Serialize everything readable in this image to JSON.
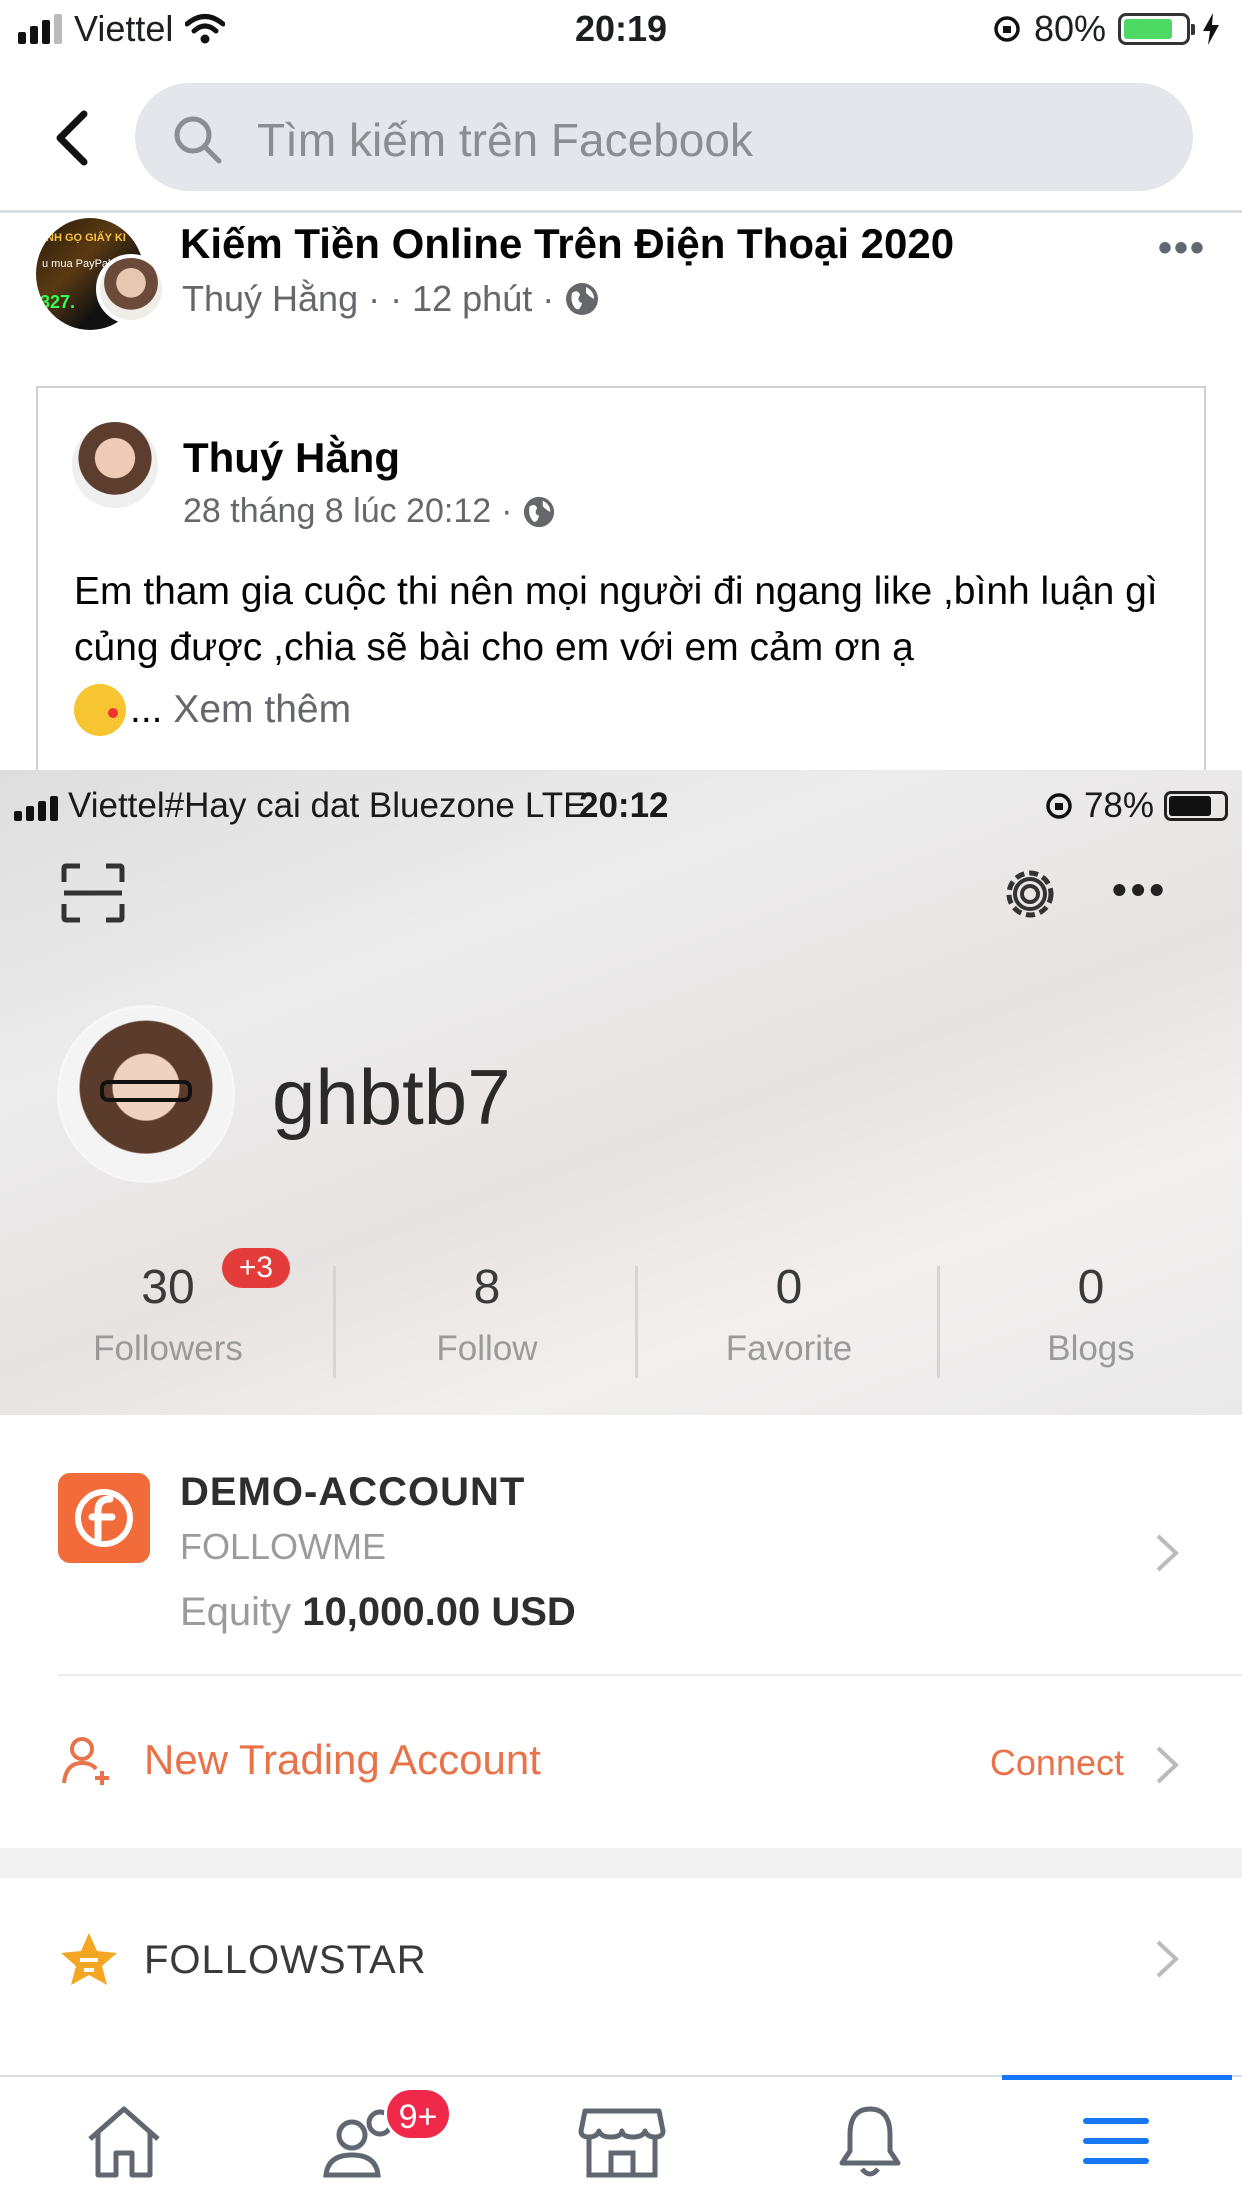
{
  "status_bar": {
    "carrier": "Viettel",
    "time": "20:19",
    "battery_percent": "80%",
    "battery_level": 0.8,
    "battery_color": "#4cd964"
  },
  "header": {
    "back_icon": "chevron-left-icon",
    "search_placeholder": "Tìm kiếm trên Facebook"
  },
  "post": {
    "group_avatar_lines": [
      "NH GỌ GIẤY KI",
      "u mua PayPal",
      "327."
    ],
    "group_name": "Kiếm Tiền Online Trên Điện Thoại 2020",
    "author": "Thuý Hằng",
    "separator": "·",
    "time": "12 phút",
    "more": "•••"
  },
  "shared_post": {
    "author": "Thuý Hằng",
    "date": "28 tháng 8 lúc 20:12",
    "separator": "·",
    "text": "Em tham gia cuộc thi nên mọi người đi ngang like ,bình luận gì củng được ,chia sẽ bài cho em với em cảm ơn ạ",
    "ellipsis": "...",
    "see_more": "Xem thêm"
  },
  "embedded_app": {
    "status_bar": {
      "carrier_text": "Viettel#Hay cai dat Bluezone",
      "network": "LTE",
      "time": "20:12",
      "battery_percent": "78%",
      "battery_level": 0.78
    },
    "username": "ghbtb7",
    "stats": [
      {
        "value": "30",
        "label": "Followers",
        "badge": "+3"
      },
      {
        "value": "8",
        "label": "Follow"
      },
      {
        "value": "0",
        "label": "Favorite"
      },
      {
        "value": "0",
        "label": "Blogs"
      }
    ],
    "account": {
      "title": "DEMO-ACCOUNT",
      "subtitle": "FOLLOWME",
      "equity_label": "Equity",
      "equity_value": "10,000.00 USD",
      "icon_color": "#f26b3a"
    },
    "new_account": {
      "label": "New Trading Account",
      "action": "Connect",
      "accent": "#e8734a"
    },
    "followstar": {
      "label": "FOLLOWSTAR"
    }
  },
  "tab_bar": {
    "tabs": [
      "home-icon",
      "friends-icon",
      "marketplace-icon",
      "notifications-icon",
      "menu-icon"
    ],
    "friends_badge": "9+",
    "active_color": "#1877f2"
  }
}
